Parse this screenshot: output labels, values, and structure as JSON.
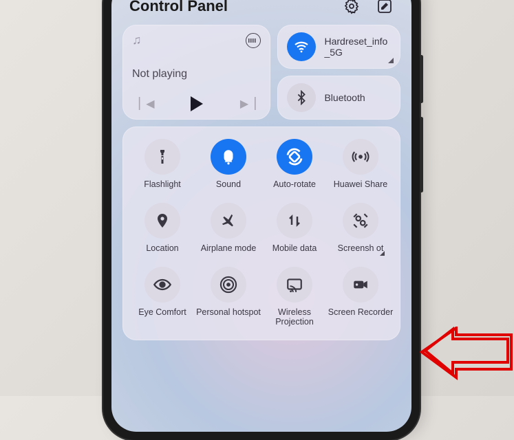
{
  "header": {
    "title": "Control Panel"
  },
  "media": {
    "status": "Not playing"
  },
  "connectivity": {
    "wifi": {
      "label": "Hardreset_info_5G",
      "active": true
    },
    "bluetooth": {
      "label": "Bluetooth",
      "active": false
    }
  },
  "toggles": [
    [
      {
        "id": "flashlight",
        "label": "Flashlight",
        "active": false
      },
      {
        "id": "sound",
        "label": "Sound",
        "active": true
      },
      {
        "id": "autorotate",
        "label": "Auto-rotate",
        "active": true
      },
      {
        "id": "huaweishare",
        "label": "Huawei Share",
        "active": false
      }
    ],
    [
      {
        "id": "location",
        "label": "Location",
        "active": false
      },
      {
        "id": "airplane",
        "label": "Airplane mode",
        "active": false
      },
      {
        "id": "mobiledata",
        "label": "Mobile data",
        "active": false
      },
      {
        "id": "screenshot",
        "label": "Screensh ot",
        "active": false,
        "expand": true
      }
    ],
    [
      {
        "id": "eyecomfort",
        "label": "Eye Comfort",
        "active": false
      },
      {
        "id": "hotspot",
        "label": "Personal hotspot",
        "active": false
      },
      {
        "id": "projection",
        "label": "Wireless Projection",
        "active": false
      },
      {
        "id": "screenrec",
        "label": "Screen Recorder",
        "active": false
      }
    ]
  ]
}
